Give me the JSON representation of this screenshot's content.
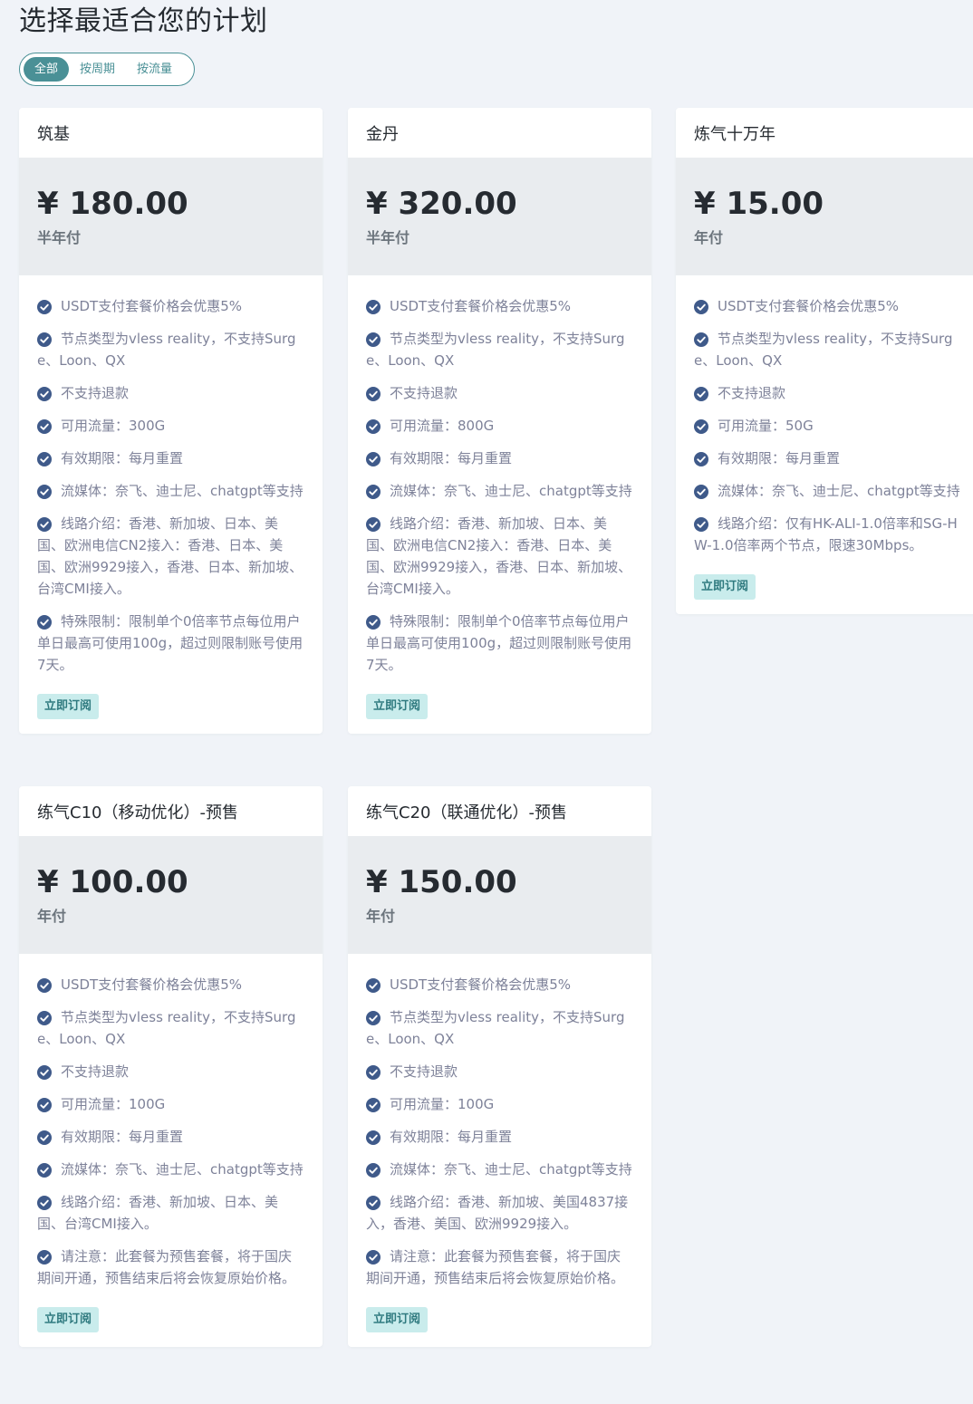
{
  "page": {
    "title": "选择最适合您的计划"
  },
  "filters": [
    {
      "label": "全部",
      "active": true
    },
    {
      "label": "按周期",
      "active": false
    },
    {
      "label": "按流量",
      "active": false
    }
  ],
  "icons": {
    "feature_check": "check-circle-icon"
  },
  "colors": {
    "accent": "#4a9096",
    "check_icon": "#3f5a8a",
    "button_bg": "#c9ecec",
    "button_text": "#2f7a7f",
    "price_block_bg": "#e9ecef",
    "page_bg": "#f0f3f8"
  },
  "plans": [
    {
      "name": "筑基",
      "price": "¥ 180.00",
      "period": "半年付",
      "features": [
        "USDT支付套餐价格会优惠5%",
        "节点类型为vless reality，不支持Surge、Loon、QX",
        "不支持退款",
        "可用流量：300G",
        "有效期限：每月重置",
        "流媒体：奈飞、迪士尼、chatgpt等支持",
        "线路介绍：香港、新加坡、日本、美国、欧洲电信CN2接入：香港、日本、美国、欧洲9929接入，香港、日本、新加坡、台湾CMI接入。",
        "特殊限制：限制单个0倍率节点每位用户单日最高可使用100g，超过则限制账号使用7天。"
      ],
      "button": "立即订阅"
    },
    {
      "name": "金丹",
      "price": "¥ 320.00",
      "period": "半年付",
      "features": [
        "USDT支付套餐价格会优惠5%",
        "节点类型为vless reality，不支持Surge、Loon、QX",
        "不支持退款",
        "可用流量：800G",
        "有效期限：每月重置",
        "流媒体：奈飞、迪士尼、chatgpt等支持",
        "线路介绍：香港、新加坡、日本、美国、欧洲电信CN2接入：香港、日本、美国、欧洲9929接入，香港、日本、新加坡、台湾CMI接入。",
        "特殊限制：限制单个0倍率节点每位用户单日最高可使用100g，超过则限制账号使用7天。"
      ],
      "button": "立即订阅"
    },
    {
      "name": "炼气十万年",
      "price": "¥ 15.00",
      "period": "年付",
      "features": [
        "USDT支付套餐价格会优惠5%",
        "节点类型为vless reality，不支持Surge、Loon、QX",
        "不支持退款",
        "可用流量：50G",
        "有效期限：每月重置",
        "流媒体：奈飞、迪士尼、chatgpt等支持",
        "线路介绍：仅有HK-ALI-1.0倍率和SG-HW-1.0倍率两个节点，限速30Mbps。"
      ],
      "button": "立即订阅"
    },
    {
      "name": "练气C10（移动优化）-预售",
      "price": "¥ 100.00",
      "period": "年付",
      "features": [
        "USDT支付套餐价格会优惠5%",
        "节点类型为vless reality，不支持Surge、Loon、QX",
        "不支持退款",
        "可用流量：100G",
        "有效期限：每月重置",
        "流媒体：奈飞、迪士尼、chatgpt等支持",
        "线路介绍：香港、新加坡、日本、美国、台湾CMI接入。",
        "请注意：此套餐为预售套餐，将于国庆期间开通，预售结束后将会恢复原始价格。"
      ],
      "button": "立即订阅"
    },
    {
      "name": "练气C20（联通优化）-预售",
      "price": "¥ 150.00",
      "period": "年付",
      "features": [
        "USDT支付套餐价格会优惠5%",
        "节点类型为vless reality，不支持Surge、Loon、QX",
        "不支持退款",
        "可用流量：100G",
        "有效期限：每月重置",
        "流媒体：奈飞、迪士尼、chatgpt等支持",
        "线路介绍：香港、新加坡、美国4837接入，香港、美国、欧洲9929接入。",
        "请注意：此套餐为预售套餐，将于国庆期间开通，预售结束后将会恢复原始价格。"
      ],
      "button": "立即订阅"
    }
  ]
}
